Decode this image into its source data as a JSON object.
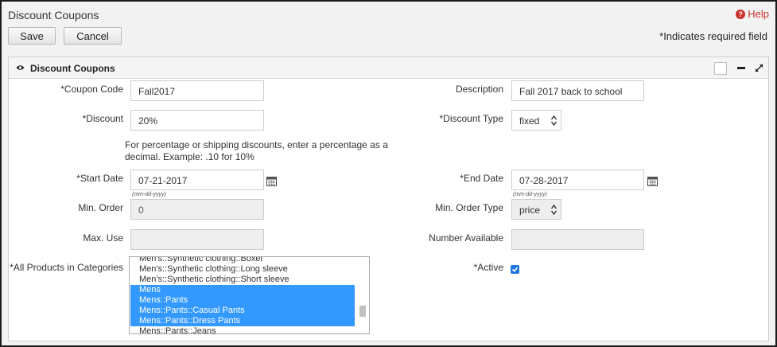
{
  "page": {
    "title": "Discount Coupons",
    "help_label": "Help",
    "required_note": "*Indicates required field"
  },
  "toolbar": {
    "save_label": "Save",
    "cancel_label": "Cancel"
  },
  "panel": {
    "title": "Discount Coupons"
  },
  "form": {
    "coupon_code": {
      "label": "*Coupon Code",
      "value": "Fall2017"
    },
    "description": {
      "label": "Description",
      "value": "Fall 2017 back to school"
    },
    "discount": {
      "label": "*Discount",
      "value": "20%",
      "hint_line1": "For percentage or shipping discounts, enter a percentage as a",
      "hint_line2": "decimal. Example: .10 for 10%"
    },
    "discount_type": {
      "label": "*Discount Type",
      "value": "fixed"
    },
    "start_date": {
      "label": "*Start Date",
      "value": "07-21-2017",
      "format": "(mm-dd-yyyy)"
    },
    "end_date": {
      "label": "*End Date",
      "value": "07-28-2017",
      "format": "(mm-dd-yyyy)"
    },
    "min_order": {
      "label": "Min. Order",
      "value": "0"
    },
    "min_order_type": {
      "label": "Min. Order Type",
      "value": "price"
    },
    "max_use": {
      "label": "Max. Use",
      "value": ""
    },
    "number_available": {
      "label": "Number Available",
      "value": ""
    },
    "categories": {
      "label": "*All Products in Categories",
      "options": [
        {
          "text": "Men's::Synthetic clothing::Boxer",
          "selected": false
        },
        {
          "text": "Men's::Synthetic clothing::Long sleeve",
          "selected": false
        },
        {
          "text": "Men's::Synthetic clothing::Short sleeve",
          "selected": false
        },
        {
          "text": "Mens",
          "selected": true
        },
        {
          "text": "Mens::Pants",
          "selected": true
        },
        {
          "text": "Mens::Pants::Casual Pants",
          "selected": true
        },
        {
          "text": "Mens::Pants::Dress Pants",
          "selected": true
        },
        {
          "text": "Mens::Pants::Jeans",
          "selected": false
        }
      ]
    },
    "active": {
      "label": "*Active",
      "checked": true
    }
  },
  "icons": {
    "help": "help-circle-icon",
    "eye": "eye-icon",
    "calendar": "calendar-icon",
    "spinner": "up-down-arrows-icon"
  },
  "colors": {
    "help": "#c9302c",
    "selection": "#3399ff",
    "checkbox": "#1e73e8"
  }
}
